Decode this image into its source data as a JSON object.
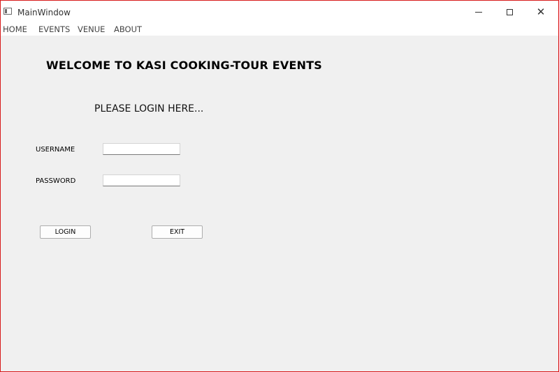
{
  "window": {
    "title": "MainWindow",
    "controls": {
      "minimize": "—",
      "maximize": "☐",
      "close": "✕"
    }
  },
  "menu": {
    "items": [
      "HOME",
      "EVENTS",
      "VENUE",
      "ABOUT"
    ]
  },
  "main": {
    "heading": "WELCOME TO KASI COOKING-TOUR EVENTS",
    "subheading": "PLEASE LOGIN HERE...",
    "username_label": "USERNAME",
    "username_value": "",
    "password_label": "PASSWORD",
    "password_value": "",
    "login_label": "LOGIN",
    "exit_label": "EXIT"
  },
  "colors": {
    "border": "#d81b1b",
    "background": "#f0f0f0"
  },
  "icons": {
    "app": "window-app-icon"
  }
}
